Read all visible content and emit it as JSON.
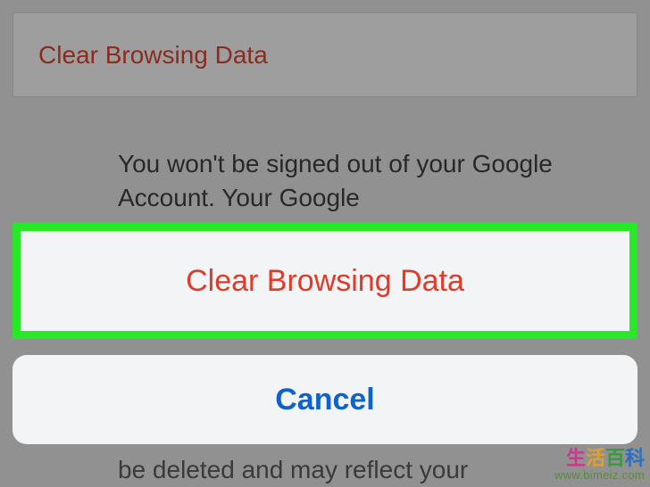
{
  "header": {
    "title": "Clear Browsing Data"
  },
  "body": {
    "message": "You won't be signed out of your Google Account. Your Google",
    "bottom_peek": "be deleted and may reflect your"
  },
  "actionsheet": {
    "destructive_label": "Clear Browsing Data",
    "cancel_label": "Cancel"
  },
  "watermark": {
    "char1": "生",
    "char2": "活",
    "char3": "百",
    "char4": "科",
    "url": "www.bimeiz.com"
  }
}
